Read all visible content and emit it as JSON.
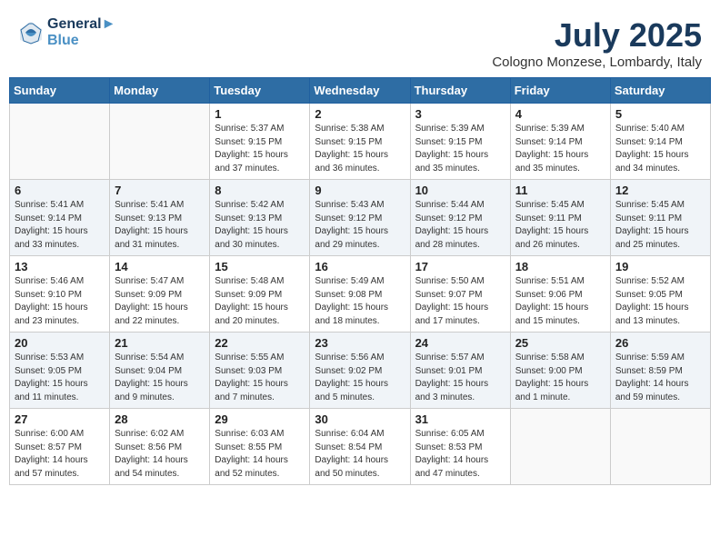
{
  "header": {
    "logo_line1": "General",
    "logo_line2": "Blue",
    "month": "July 2025",
    "location": "Cologno Monzese, Lombardy, Italy"
  },
  "weekdays": [
    "Sunday",
    "Monday",
    "Tuesday",
    "Wednesday",
    "Thursday",
    "Friday",
    "Saturday"
  ],
  "weeks": [
    [
      {
        "day": "",
        "info": ""
      },
      {
        "day": "",
        "info": ""
      },
      {
        "day": "1",
        "info": "Sunrise: 5:37 AM\nSunset: 9:15 PM\nDaylight: 15 hours\nand 37 minutes."
      },
      {
        "day": "2",
        "info": "Sunrise: 5:38 AM\nSunset: 9:15 PM\nDaylight: 15 hours\nand 36 minutes."
      },
      {
        "day": "3",
        "info": "Sunrise: 5:39 AM\nSunset: 9:15 PM\nDaylight: 15 hours\nand 35 minutes."
      },
      {
        "day": "4",
        "info": "Sunrise: 5:39 AM\nSunset: 9:14 PM\nDaylight: 15 hours\nand 35 minutes."
      },
      {
        "day": "5",
        "info": "Sunrise: 5:40 AM\nSunset: 9:14 PM\nDaylight: 15 hours\nand 34 minutes."
      }
    ],
    [
      {
        "day": "6",
        "info": "Sunrise: 5:41 AM\nSunset: 9:14 PM\nDaylight: 15 hours\nand 33 minutes."
      },
      {
        "day": "7",
        "info": "Sunrise: 5:41 AM\nSunset: 9:13 PM\nDaylight: 15 hours\nand 31 minutes."
      },
      {
        "day": "8",
        "info": "Sunrise: 5:42 AM\nSunset: 9:13 PM\nDaylight: 15 hours\nand 30 minutes."
      },
      {
        "day": "9",
        "info": "Sunrise: 5:43 AM\nSunset: 9:12 PM\nDaylight: 15 hours\nand 29 minutes."
      },
      {
        "day": "10",
        "info": "Sunrise: 5:44 AM\nSunset: 9:12 PM\nDaylight: 15 hours\nand 28 minutes."
      },
      {
        "day": "11",
        "info": "Sunrise: 5:45 AM\nSunset: 9:11 PM\nDaylight: 15 hours\nand 26 minutes."
      },
      {
        "day": "12",
        "info": "Sunrise: 5:45 AM\nSunset: 9:11 PM\nDaylight: 15 hours\nand 25 minutes."
      }
    ],
    [
      {
        "day": "13",
        "info": "Sunrise: 5:46 AM\nSunset: 9:10 PM\nDaylight: 15 hours\nand 23 minutes."
      },
      {
        "day": "14",
        "info": "Sunrise: 5:47 AM\nSunset: 9:09 PM\nDaylight: 15 hours\nand 22 minutes."
      },
      {
        "day": "15",
        "info": "Sunrise: 5:48 AM\nSunset: 9:09 PM\nDaylight: 15 hours\nand 20 minutes."
      },
      {
        "day": "16",
        "info": "Sunrise: 5:49 AM\nSunset: 9:08 PM\nDaylight: 15 hours\nand 18 minutes."
      },
      {
        "day": "17",
        "info": "Sunrise: 5:50 AM\nSunset: 9:07 PM\nDaylight: 15 hours\nand 17 minutes."
      },
      {
        "day": "18",
        "info": "Sunrise: 5:51 AM\nSunset: 9:06 PM\nDaylight: 15 hours\nand 15 minutes."
      },
      {
        "day": "19",
        "info": "Sunrise: 5:52 AM\nSunset: 9:05 PM\nDaylight: 15 hours\nand 13 minutes."
      }
    ],
    [
      {
        "day": "20",
        "info": "Sunrise: 5:53 AM\nSunset: 9:05 PM\nDaylight: 15 hours\nand 11 minutes."
      },
      {
        "day": "21",
        "info": "Sunrise: 5:54 AM\nSunset: 9:04 PM\nDaylight: 15 hours\nand 9 minutes."
      },
      {
        "day": "22",
        "info": "Sunrise: 5:55 AM\nSunset: 9:03 PM\nDaylight: 15 hours\nand 7 minutes."
      },
      {
        "day": "23",
        "info": "Sunrise: 5:56 AM\nSunset: 9:02 PM\nDaylight: 15 hours\nand 5 minutes."
      },
      {
        "day": "24",
        "info": "Sunrise: 5:57 AM\nSunset: 9:01 PM\nDaylight: 15 hours\nand 3 minutes."
      },
      {
        "day": "25",
        "info": "Sunrise: 5:58 AM\nSunset: 9:00 PM\nDaylight: 15 hours\nand 1 minute."
      },
      {
        "day": "26",
        "info": "Sunrise: 5:59 AM\nSunset: 8:59 PM\nDaylight: 14 hours\nand 59 minutes."
      }
    ],
    [
      {
        "day": "27",
        "info": "Sunrise: 6:00 AM\nSunset: 8:57 PM\nDaylight: 14 hours\nand 57 minutes."
      },
      {
        "day": "28",
        "info": "Sunrise: 6:02 AM\nSunset: 8:56 PM\nDaylight: 14 hours\nand 54 minutes."
      },
      {
        "day": "29",
        "info": "Sunrise: 6:03 AM\nSunset: 8:55 PM\nDaylight: 14 hours\nand 52 minutes."
      },
      {
        "day": "30",
        "info": "Sunrise: 6:04 AM\nSunset: 8:54 PM\nDaylight: 14 hours\nand 50 minutes."
      },
      {
        "day": "31",
        "info": "Sunrise: 6:05 AM\nSunset: 8:53 PM\nDaylight: 14 hours\nand 47 minutes."
      },
      {
        "day": "",
        "info": ""
      },
      {
        "day": "",
        "info": ""
      }
    ]
  ]
}
